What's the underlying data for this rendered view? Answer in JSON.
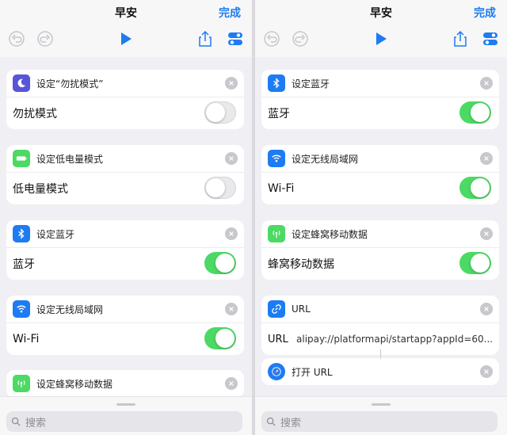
{
  "screens": [
    {
      "title": "早安",
      "done": "完成",
      "cards": [
        {
          "title": "设定“勿扰模式”",
          "label": "勿扰模式",
          "toggle": false,
          "icon": "moon-icon",
          "color": "#5856d6"
        },
        {
          "title": "设定低电量模式",
          "label": "低电量模式",
          "toggle": false,
          "icon": "battery-icon",
          "color": "#4cd964"
        },
        {
          "title": "设定蓝牙",
          "label": "蓝牙",
          "toggle": true,
          "icon": "bluetooth-icon",
          "color": "#1d7cf2"
        },
        {
          "title": "设定无线局域网",
          "label": "Wi-Fi",
          "toggle": true,
          "icon": "wifi-icon",
          "color": "#1d7cf2"
        },
        {
          "title": "设定蜂窝移动数据",
          "label": "",
          "toggle": null,
          "icon": "cellular-icon",
          "color": "#4cd964"
        }
      ],
      "search": {
        "placeholder": "搜索"
      }
    },
    {
      "title": "早安",
      "done": "完成",
      "cards": [
        {
          "title": "设定蓝牙",
          "label": "蓝牙",
          "toggle": true,
          "icon": "bluetooth-icon",
          "color": "#1d7cf2"
        },
        {
          "title": "设定无线局域网",
          "label": "Wi-Fi",
          "toggle": true,
          "icon": "wifi-icon",
          "color": "#1d7cf2"
        },
        {
          "title": "设定蜂窝移动数据",
          "label": "蜂窝移动数据",
          "toggle": true,
          "icon": "cellular-icon",
          "color": "#4cd964"
        },
        {
          "title": "URL",
          "label": "URL",
          "value": "alipay://platformapi/startapp?appId=60...",
          "icon": "link-icon",
          "color": "#1d7cf2"
        },
        {
          "title": "打开 URL",
          "icon": "safari-icon",
          "color": "#1d7cf2"
        }
      ],
      "search": {
        "placeholder": "搜索"
      }
    }
  ]
}
